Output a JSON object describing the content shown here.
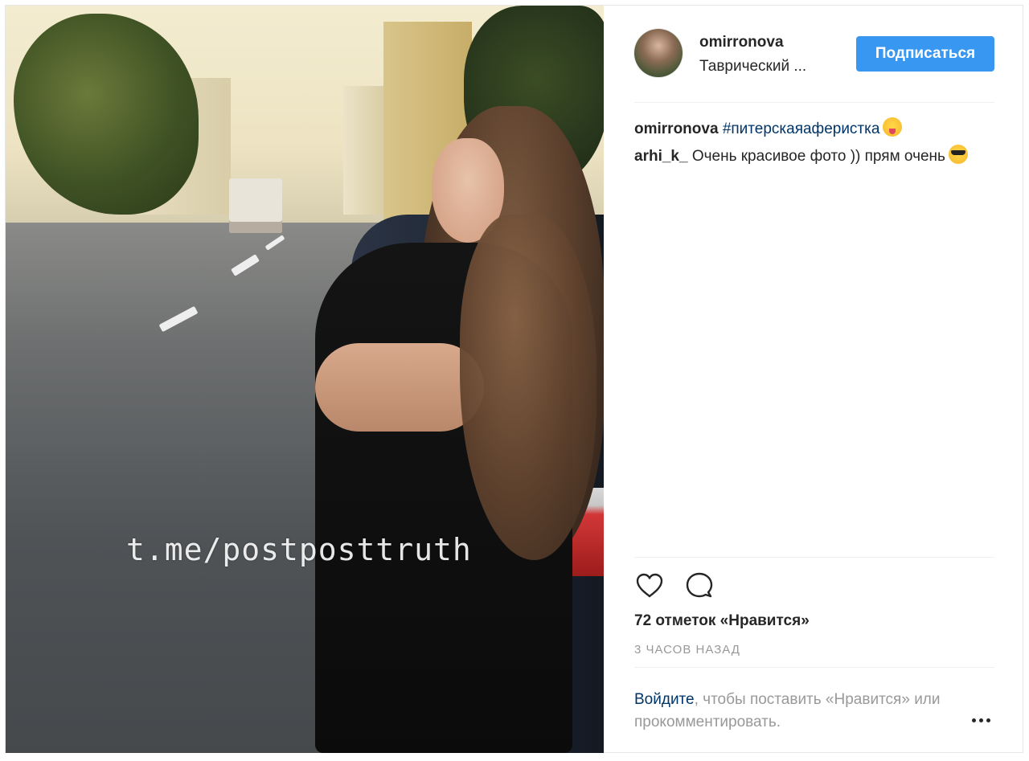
{
  "post": {
    "watermark": "t.me/postposttruth",
    "author": "omirronova",
    "location": "Таврический ...",
    "follow_label": "Подписаться",
    "caption": {
      "user": "omirronova",
      "hashtag": "#питерскаяаферистка",
      "emoji": "winking-face-with-tongue-emoji"
    },
    "comments": [
      {
        "user": "arhi_k_",
        "text": "Очень красивое фото )) прям очень",
        "emoji": "smiling-face-with-sunglasses-emoji"
      }
    ],
    "likes_text": "72 отметок «Нравится»",
    "timestamp": "3 ЧАСОВ НАЗАД",
    "login_link": "Войдите",
    "login_rest": ", чтобы поставить «Нравится» или прокомментировать.",
    "icons": {
      "like": "heart-icon",
      "comment": "comment-icon",
      "more": "more-options-icon"
    },
    "accent_color": "#3897f0",
    "link_color": "#003569"
  }
}
